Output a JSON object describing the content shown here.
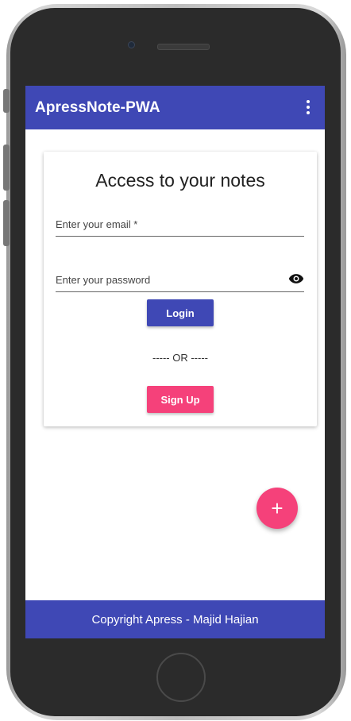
{
  "app": {
    "title": "ApressNote-PWA",
    "menu_icon": "more-vert-icon"
  },
  "login_card": {
    "heading": "Access to your notes",
    "email_placeholder": "Enter your email *",
    "password_placeholder": "Enter your password",
    "password_visibility_icon": "eye-icon",
    "login_label": "Login",
    "separator": "----- OR -----",
    "signup_label": "Sign Up"
  },
  "fab": {
    "label": "+",
    "icon": "add-icon"
  },
  "footer": {
    "text": "Copyright Apress - Majid Hajian"
  },
  "colors": {
    "primary": "#3f48b5",
    "accent": "#f5417a",
    "surface": "#ffffff"
  }
}
